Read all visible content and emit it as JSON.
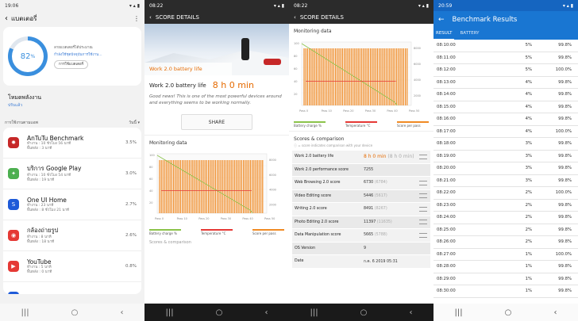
{
  "phone1": {
    "status": {
      "time": "19:06"
    },
    "header": {
      "title": "แบตเตอรี่"
    },
    "gauge": {
      "percent_label": "82",
      "percent_unit": "%",
      "percent_value": 82,
      "line1": "ลายแบตเตอรี่ได้ประมาณ",
      "line2": "กำลังใช้ชุดปัจจุบันการใช้งาน...",
      "button": "การใช้แบตเตอรี่"
    },
    "power_mode": {
      "title": "โหมดพลังงาน",
      "sub": "ปรับแล้ว"
    },
    "usage": {
      "label": "การใช้งานตามแอพ",
      "filter": "วันนี้"
    },
    "apps": [
      {
        "name": "AnTuTu Benchmark",
        "l1": "ทำงาน : 10 ชั่วโมง 56 นาที",
        "l2": "พื้นหลัง : 3 นาที",
        "pct": "3.5%",
        "color": "#c62828",
        "glyph": "✹"
      },
      {
        "name": "บริการ Google Play",
        "l1": "ทำงาน : 10 ชั่วโมง 54 นาที",
        "l2": "พื้นหลัง : 19 นาที",
        "pct": "3.0%",
        "color": "#4caf50",
        "glyph": "✦"
      },
      {
        "name": "One UI Home",
        "l1": "ทำงาน : 23 นาที",
        "l2": "พื้นหลัง : 8 ชั่วโมง 21 นาที",
        "pct": "2.7%",
        "color": "#1e5ad8",
        "glyph": "S"
      },
      {
        "name": "กล้องถ่ายรูป",
        "l1": "ทำงาน : 8 นาที",
        "l2": "พื้นหลัง : 18 นาที",
        "pct": "2.6%",
        "color": "#e53935",
        "glyph": "◉"
      },
      {
        "name": "YouTube",
        "l1": "ทำงาน : 5 นาที",
        "l2": "พื้นหลัง : 0 นาที",
        "pct": "0.8%",
        "color": "#e53935",
        "glyph": "▶"
      },
      {
        "name": "Real Racing 3",
        "l1": "",
        "l2": "",
        "pct": "",
        "color": "#1e5ad8",
        "glyph": "R"
      }
    ]
  },
  "phone2": {
    "status": {
      "time": "08:22"
    },
    "header": {
      "title": "SCORE DETAILS"
    },
    "hero": {
      "banner": "Work 2.0 battery life"
    },
    "score": {
      "label": "Work 2.0 battery life",
      "value": "8 h 0 min"
    },
    "message": "Good news! This is one of the most powerful devices around and everything seems to be working normally.",
    "share": "SHARE",
    "monitoring": "Monitoring data",
    "legend": [
      "Battery charge %",
      "Temperature °C",
      "Score per pass"
    ],
    "x_ticks": [
      "Pass 0",
      "Pass 10",
      "Pass 20",
      "Pass 30",
      "Pass 40",
      "Pass 50"
    ],
    "y_ticks": [
      "100",
      "80",
      "60",
      "40",
      "20"
    ],
    "y2_ticks": [
      "8000",
      "6000",
      "4000",
      "2000"
    ],
    "next": "Scores & comparison"
  },
  "phone3": {
    "status": {
      "time": "08:22"
    },
    "header": {
      "title": "SCORE DETAILS"
    },
    "monitoring": "Monitoring data",
    "legend": [
      "Battery charge %",
      "Temperature °C",
      "Score per pass"
    ],
    "x_ticks": [
      "Pass 0",
      "Pass 10",
      "Pass 20",
      "Pass 30",
      "Pass 40",
      "Pass 50"
    ],
    "y_ticks": [
      "100",
      "80",
      "60",
      "40",
      "20"
    ],
    "y2_ticks": [
      "8000",
      "6000",
      "4000",
      "2000"
    ],
    "scores_title": "Scores & comparison",
    "scores_sub": "ⓘ = score indicates comparison with your device",
    "rows": [
      {
        "k": "Work 2.0 battery life",
        "v": "8 h 0 min",
        "d": "(8 h 0 min)",
        "big": true,
        "icon": true
      },
      {
        "k": "Work 2.0 performance score",
        "v": "7255",
        "d": "",
        "big": false,
        "icon": false
      },
      {
        "k": "Web Browsing 2.0 score",
        "v": "6730",
        "d": "(6784)",
        "big": false,
        "icon": true
      },
      {
        "k": "Video Editing score",
        "v": "5446",
        "d": "(5617)",
        "big": false,
        "icon": true
      },
      {
        "k": "Writing 2.0 score",
        "v": "8491",
        "d": "(8267)",
        "big": false,
        "icon": true
      },
      {
        "k": "Photo Editing 2.0 score",
        "v": "11397",
        "d": "(11635)",
        "big": false,
        "icon": true
      },
      {
        "k": "Data Manipulation score",
        "v": "5665",
        "d": "(5788)",
        "big": false,
        "icon": true
      },
      {
        "k": "OS Version",
        "v": "9",
        "d": "",
        "big": false,
        "icon": false
      },
      {
        "k": "Date",
        "v": "ก.ค. 6 2019 05:31",
        "d": "",
        "big": false,
        "icon": false
      }
    ]
  },
  "phone4": {
    "status": {
      "time": "20:59"
    },
    "header": {
      "title": "Benchmark Results"
    },
    "tabs": [
      "RESULT",
      "BATTERY"
    ],
    "rows": [
      [
        "08:10:00",
        "5%",
        "99.8%"
      ],
      [
        "08:11:00",
        "5%",
        "99.8%"
      ],
      [
        "08:12:00",
        "5%",
        "100.0%"
      ],
      [
        "08:13:00",
        "4%",
        "99.8%"
      ],
      [
        "08:14:00",
        "4%",
        "99.8%"
      ],
      [
        "08:15:00",
        "4%",
        "99.8%"
      ],
      [
        "08:16:00",
        "4%",
        "99.8%"
      ],
      [
        "08:17:00",
        "4%",
        "100.0%"
      ],
      [
        "08:18:00",
        "3%",
        "99.8%"
      ],
      [
        "08:19:00",
        "3%",
        "99.8%"
      ],
      [
        "08:20:00",
        "3%",
        "99.8%"
      ],
      [
        "08:21:00",
        "3%",
        "99.8%"
      ],
      [
        "08:22:00",
        "2%",
        "100.0%"
      ],
      [
        "08:23:00",
        "2%",
        "99.8%"
      ],
      [
        "08:24:00",
        "2%",
        "99.8%"
      ],
      [
        "08:25:00",
        "2%",
        "99.8%"
      ],
      [
        "08:26:00",
        "2%",
        "99.8%"
      ],
      [
        "08:27:00",
        "1%",
        "100.0%"
      ],
      [
        "08:28:00",
        "1%",
        "99.8%"
      ],
      [
        "08:29:00",
        "1%",
        "99.8%"
      ],
      [
        "08:30:00",
        "1%",
        "99.8%"
      ]
    ]
  }
}
